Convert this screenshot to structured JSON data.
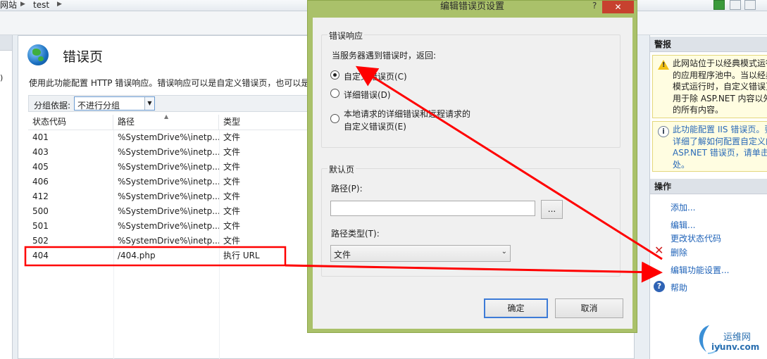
{
  "breadcrumb": {
    "site_label": "网站",
    "site_name": "test"
  },
  "left_nav": {
    "stub_text": ")"
  },
  "main": {
    "page_title": "错误页",
    "description": "使用此功能配置 HTTP 错误响应。错误响应可以是自定义错误页，也可以是",
    "group_by_label": "分组依据:",
    "group_by_value": "不进行分组",
    "columns": [
      "状态代码",
      "路径",
      "类型"
    ],
    "rows": [
      {
        "code": "401",
        "path": "%SystemDrive%\\inetp...",
        "type": "文件"
      },
      {
        "code": "403",
        "path": "%SystemDrive%\\inetp...",
        "type": "文件"
      },
      {
        "code": "405",
        "path": "%SystemDrive%\\inetp...",
        "type": "文件"
      },
      {
        "code": "406",
        "path": "%SystemDrive%\\inetp...",
        "type": "文件"
      },
      {
        "code": "412",
        "path": "%SystemDrive%\\inetp...",
        "type": "文件"
      },
      {
        "code": "500",
        "path": "%SystemDrive%\\inetp...",
        "type": "文件"
      },
      {
        "code": "501",
        "path": "%SystemDrive%\\inetp...",
        "type": "文件"
      },
      {
        "code": "502",
        "path": "%SystemDrive%\\inetp...",
        "type": "文件"
      },
      {
        "code": "404",
        "path": "/404.php",
        "type": "执行 URL"
      }
    ]
  },
  "dialog": {
    "title": "编辑错误页设置",
    "help_glyph": "?",
    "close_glyph": "✕",
    "error_response_legend": "错误响应",
    "error_response_prompt": "当服务器遇到错误时，返回:",
    "option_custom": "自定义错误页(C)",
    "option_detailed": "详细错误(D)",
    "option_local_line1": "本地请求的详细错误和远程请求的",
    "option_local_line2": "自定义错误页(E)",
    "selected_option": "custom",
    "default_page_legend": "默认页",
    "path_label": "路径(P):",
    "path_value": "",
    "browse_label": "...",
    "path_type_label": "路径类型(T):",
    "path_type_value": "文件",
    "ok_label": "确定",
    "cancel_label": "取消"
  },
  "right_panel": {
    "alerts_header": "警报",
    "warning_text": "此网站位于以经典模式运行\n的应用程序池中。当以经典\n模式运行时，自定义错误页\n用于除 ASP.NET 内容以外\n的所有内容。",
    "info_text": "此功能配置 IIS 错误页。要\n详细了解如何配置自定义的\nASP.NET 错误页，请单击\n处。",
    "actions_header": "操作",
    "actions": {
      "add": "添加...",
      "edit": "编辑...",
      "change_status": "更改状态代码",
      "delete": "删除",
      "edit_feature": "编辑功能设置...",
      "help": "帮助"
    }
  },
  "watermark": {
    "name": "运维网",
    "url": "iyunv.com"
  },
  "colors": {
    "dialog_frame": "#aac16a",
    "annotation": "#ff0000",
    "link": "#1e62b8"
  }
}
